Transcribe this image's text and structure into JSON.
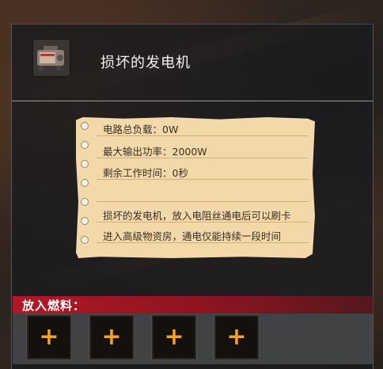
{
  "item": {
    "title": "损坏的发电机",
    "icon": "generator-icon"
  },
  "note": {
    "lines": [
      "电路总负载：0W",
      "最大输出功率：2000W",
      "剩余工作时间：0秒",
      "",
      "损坏的发电机，放入电阻丝通电后可以刷卡",
      "进入高级物资房，通电仅能持续一段时间"
    ]
  },
  "fuel": {
    "label": "放入燃料：",
    "slots": [
      "+",
      "+",
      "+",
      "+"
    ]
  },
  "colors": {
    "accent_red": "#b11826",
    "plus_orange": "#f4a22b",
    "paper": "#f3d8aa"
  }
}
